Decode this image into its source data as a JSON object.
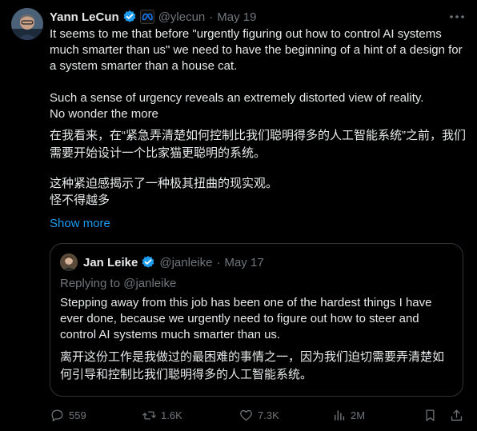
{
  "tweet": {
    "author_name": "Yann LeCun",
    "handle": "@ylecun",
    "separator": "·",
    "date": "May 19",
    "paragraphs": [
      "It seems to me that before \"urgently figuring out how to control AI systems much smarter than us\" we need to have the beginning of a hint of a design for a system smarter than a house cat.",
      "Such a sense of urgency reveals an extremely distorted view of reality.\nNo wonder the more",
      "在我看来，在“紧急弄清楚如何控制比我们聪明得多的人工智能系统”之前，我们需要开始设计一个比家猫更聪明的系统。",
      "这种紧迫感揭示了一种极其扭曲的现实观。\n怪不得越多"
    ],
    "show_more": "Show more"
  },
  "quoted": {
    "author_name": "Jan Leike",
    "handle": "@janleike",
    "separator": "·",
    "date": "May 17",
    "replying_to": "Replying to @janleike",
    "paragraphs": [
      "Stepping away from this job has been one of the hardest things I have ever done, because we urgently need to figure out how to steer and control AI systems much smarter than us.",
      "离开这份工作是我做过的最困难的事情之一，因为我们迫切需要弄清楚如何引导和控制比我们聪明得多的人工智能系统。"
    ]
  },
  "actions": {
    "replies": "559",
    "reposts": "1.6K",
    "likes": "7.3K",
    "views": "2M"
  },
  "colors": {
    "background": "#000000",
    "text": "#e7e9ea",
    "muted": "#71767b",
    "accent": "#1d9bf0",
    "border": "#2f3336"
  },
  "icons": [
    "verified-badge-icon",
    "meta-logo-icon",
    "more-icon",
    "reply-icon",
    "repost-icon",
    "like-icon",
    "views-icon",
    "bookmark-icon",
    "share-icon"
  ]
}
